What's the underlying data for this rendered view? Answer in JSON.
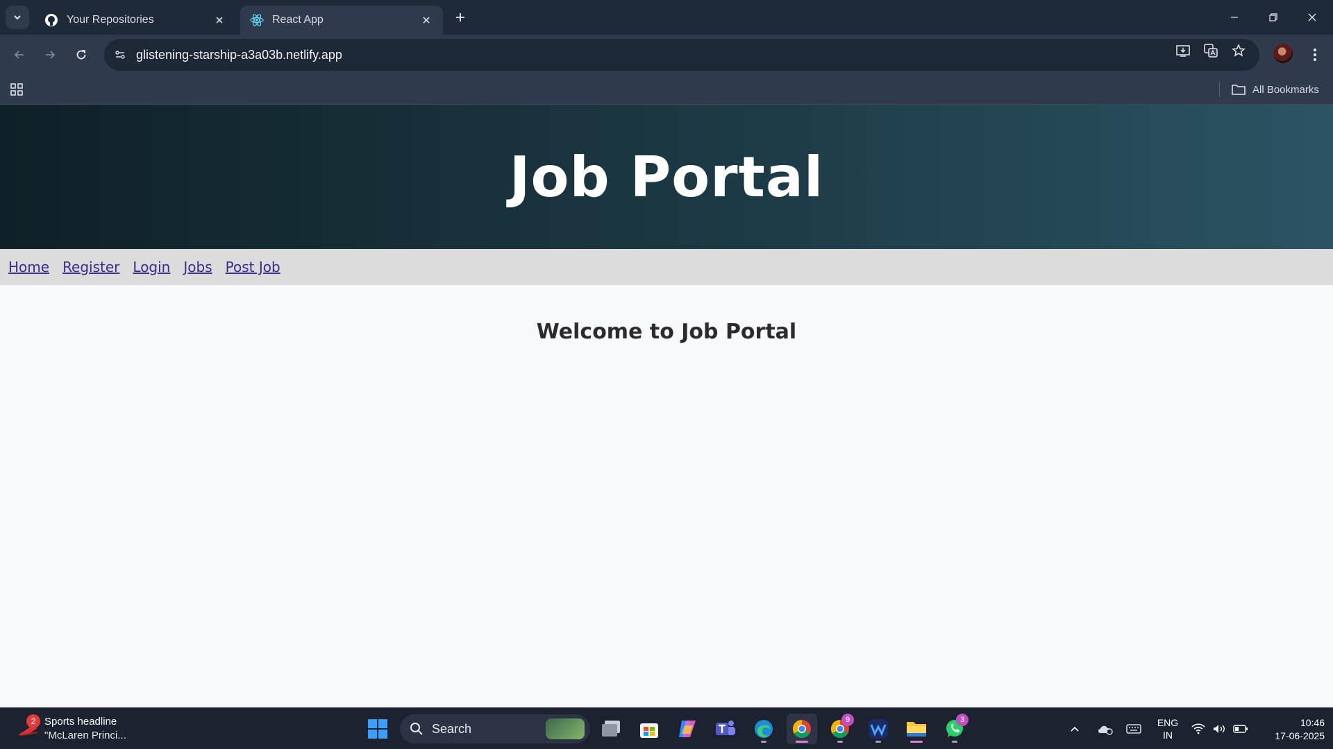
{
  "browser": {
    "tabs": [
      {
        "title": "Your Repositories",
        "icon": "github-icon",
        "active": false
      },
      {
        "title": "React App",
        "icon": "react-icon",
        "active": true
      }
    ],
    "url": "glistening-starship-a3a03b.netlify.app",
    "bookmarks_label": "All Bookmarks"
  },
  "page": {
    "hero_title": "Job Portal",
    "nav_links": [
      "Home",
      "Register",
      "Login",
      "Jobs",
      "Post Job"
    ],
    "welcome": "Welcome to Job Portal"
  },
  "taskbar": {
    "news_badge": "2",
    "news_title": "Sports headline",
    "news_sub": "\"McLaren Princi...",
    "search_label": "Search",
    "chrome2_badge": "9",
    "whatsapp_badge": "3",
    "lang_line1": "ENG",
    "lang_line2": "IN",
    "time": "10:46",
    "date": "17-06-2025"
  },
  "colors": {
    "hero_start": "#0f2027",
    "hero_end": "#2c5364",
    "nav_link": "#3a2b8c",
    "navbar_bg": "#dcdcdc"
  }
}
